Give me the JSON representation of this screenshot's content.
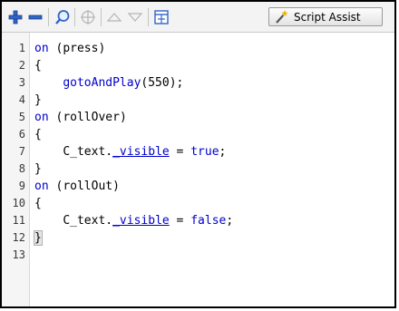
{
  "toolbar": {
    "script_assist_label": "Script Assist"
  },
  "icons": {
    "add": "plus-icon",
    "remove": "minus-icon",
    "find": "magnifier-icon",
    "target": "crosshair-target-icon",
    "up": "arrow-up-icon",
    "down": "arrow-down-icon",
    "reference": "reference-panel-icon",
    "wand": "magic-wand-icon"
  },
  "colors": {
    "keyword": "#0000cc",
    "text": "#000000",
    "gutter": "#f5f5f5"
  },
  "code": {
    "lines": [
      {
        "num": "1",
        "indent": "",
        "tokens": [
          {
            "t": "on",
            "c": "kw"
          },
          {
            "t": " (",
            "c": ""
          },
          {
            "t": "press",
            "c": ""
          },
          {
            "t": ")",
            "c": ""
          }
        ]
      },
      {
        "num": "2",
        "indent": "",
        "tokens": [
          {
            "t": "{",
            "c": ""
          }
        ]
      },
      {
        "num": "3",
        "indent": "    ",
        "tokens": [
          {
            "t": "gotoAndPlay",
            "c": "fn"
          },
          {
            "t": "(550);",
            "c": ""
          }
        ]
      },
      {
        "num": "4",
        "indent": "",
        "tokens": [
          {
            "t": "}",
            "c": ""
          }
        ]
      },
      {
        "num": "5",
        "indent": "",
        "tokens": [
          {
            "t": "on",
            "c": "kw"
          },
          {
            "t": " (",
            "c": ""
          },
          {
            "t": "rollOver",
            "c": ""
          },
          {
            "t": ")",
            "c": ""
          }
        ]
      },
      {
        "num": "6",
        "indent": "",
        "tokens": [
          {
            "t": "{",
            "c": ""
          }
        ]
      },
      {
        "num": "7",
        "indent": "    ",
        "tokens": [
          {
            "t": "C_text.",
            "c": ""
          },
          {
            "t": "_visible",
            "c": "prop"
          },
          {
            "t": " = ",
            "c": ""
          },
          {
            "t": "true",
            "c": "kw"
          },
          {
            "t": ";",
            "c": ""
          }
        ]
      },
      {
        "num": "8",
        "indent": "",
        "tokens": [
          {
            "t": "}",
            "c": ""
          }
        ]
      },
      {
        "num": "9",
        "indent": "",
        "tokens": [
          {
            "t": "on",
            "c": "kw"
          },
          {
            "t": " (",
            "c": ""
          },
          {
            "t": "rollOut",
            "c": ""
          },
          {
            "t": ")",
            "c": ""
          }
        ]
      },
      {
        "num": "10",
        "indent": "",
        "tokens": [
          {
            "t": "{",
            "c": ""
          }
        ]
      },
      {
        "num": "11",
        "indent": "    ",
        "tokens": [
          {
            "t": "C_text.",
            "c": ""
          },
          {
            "t": "_visible",
            "c": "prop"
          },
          {
            "t": " = ",
            "c": ""
          },
          {
            "t": "false",
            "c": "kw"
          },
          {
            "t": ";",
            "c": ""
          }
        ]
      },
      {
        "num": "12",
        "indent": "",
        "tokens": [
          {
            "t": "}",
            "c": "brace-hl"
          }
        ]
      },
      {
        "num": "13",
        "indent": "",
        "tokens": []
      }
    ]
  }
}
